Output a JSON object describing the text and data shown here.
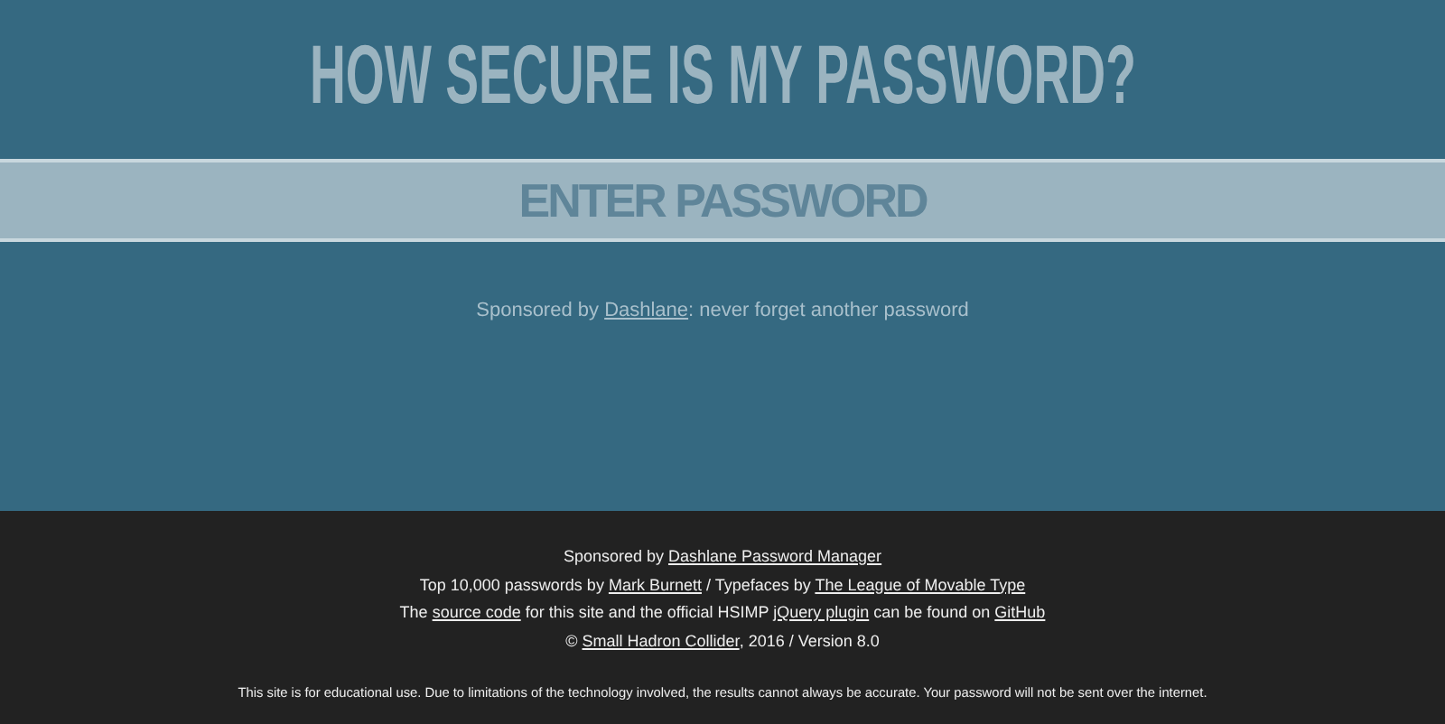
{
  "title": "HOW SECURE IS MY PASSWORD?",
  "password": {
    "placeholder": "ENTER PASSWORD"
  },
  "sponsor": [
    {
      "kind": "text",
      "text": "Sponsored by "
    },
    {
      "kind": "link",
      "text": "Dashlane"
    },
    {
      "kind": "text",
      "text": ": never forget another password"
    }
  ],
  "footer": {
    "lines": [
      [
        {
          "kind": "text",
          "text": "Sponsored by "
        },
        {
          "kind": "link",
          "text": "Dashlane Password Manager"
        }
      ],
      [
        {
          "kind": "text",
          "text": "Top 10,000 passwords by "
        },
        {
          "kind": "link",
          "text": "Mark Burnett"
        },
        {
          "kind": "text",
          "text": " / Typefaces by "
        },
        {
          "kind": "link",
          "text": "The League of Movable Type"
        }
      ],
      [
        {
          "kind": "text",
          "text": "The "
        },
        {
          "kind": "link",
          "text": "source code"
        },
        {
          "kind": "text",
          "text": " for this site and the official HSIMP "
        },
        {
          "kind": "link",
          "text": "jQuery plugin"
        },
        {
          "kind": "text",
          "text": " can be found on "
        },
        {
          "kind": "link",
          "text": "GitHub"
        }
      ],
      [
        {
          "kind": "text",
          "text": "© "
        },
        {
          "kind": "link",
          "text": "Small Hadron Collider"
        },
        {
          "kind": "text",
          "text": ", 2016 / Version 8.0"
        }
      ]
    ],
    "disclaimer": "This site is for educational use. Due to limitations of the technology involved, the results cannot always be accurate. Your password will not be sent over the internet."
  }
}
